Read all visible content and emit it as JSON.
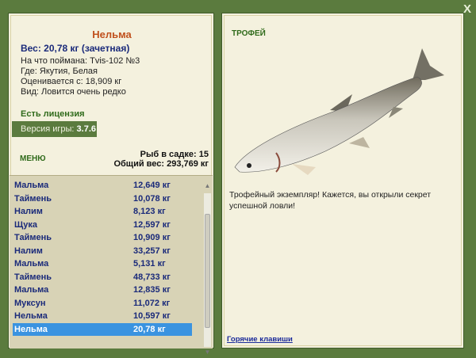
{
  "window": {
    "close_label": "X"
  },
  "catch": {
    "fish_name": "Нельма",
    "weight": "Вес: 20,78 кг (зачетная)",
    "caught_on": "На что поймана: Tvis-102 №3",
    "where": "Где: Якутия, Белая",
    "valued_from": "Оценивается с: 18,909 кг",
    "kind": "Вид: Ловится очень редко",
    "license": "Есть лицензия",
    "version_label": "Версия игры:",
    "version_value": "3.7.6"
  },
  "menu_label": "МЕНЮ",
  "stats": {
    "count": "Рыб в садке: 15",
    "total": "Общий вес: 293,769 кг"
  },
  "catch_list": [
    {
      "name": "Мальма",
      "weight": "12,649 кг"
    },
    {
      "name": "Таймень",
      "weight": "10,078 кг"
    },
    {
      "name": "Налим",
      "weight": "8,123 кг"
    },
    {
      "name": "Щука",
      "weight": "12,597 кг"
    },
    {
      "name": "Таймень",
      "weight": "10,909 кг"
    },
    {
      "name": "Налим",
      "weight": "33,257 кг"
    },
    {
      "name": "Мальма",
      "weight": "5,131 кг"
    },
    {
      "name": "Таймень",
      "weight": "48,733 кг"
    },
    {
      "name": "Мальма",
      "weight": "12,835 кг"
    },
    {
      "name": "Муксун",
      "weight": "11,072 кг"
    },
    {
      "name": "Нельма",
      "weight": "10,597 кг"
    },
    {
      "name": "Нельма",
      "weight": "20,78 кг",
      "selected": true
    }
  ],
  "trophy": {
    "title": "ТРОФЕЙ",
    "text": "Трофейный экземпляр! Кажется, вы открыли секрет успешной ловли!",
    "hotkeys": "Горячие клавиши"
  }
}
